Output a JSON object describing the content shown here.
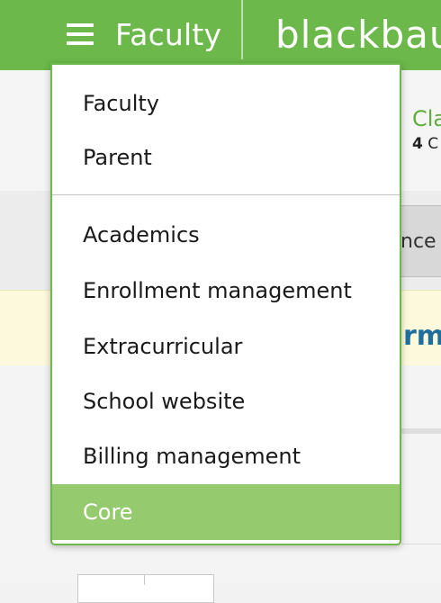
{
  "topbar": {
    "persona_label": "Faculty",
    "brand_text": "blackbaud",
    "accent_color": "#6cb84a"
  },
  "menu": {
    "personas": [
      "Faculty",
      "Parent"
    ],
    "sections": [
      "Academics",
      "Enrollment management",
      "Extracurricular",
      "School website",
      "Billing management",
      "Core"
    ],
    "active_item": "Core",
    "active_color": "#96ca6f"
  },
  "background": {
    "class_title": "Cla",
    "class_sub_count": "4",
    "class_sub_rest": "C",
    "tab_label": "nce",
    "notice_text": "rm"
  }
}
